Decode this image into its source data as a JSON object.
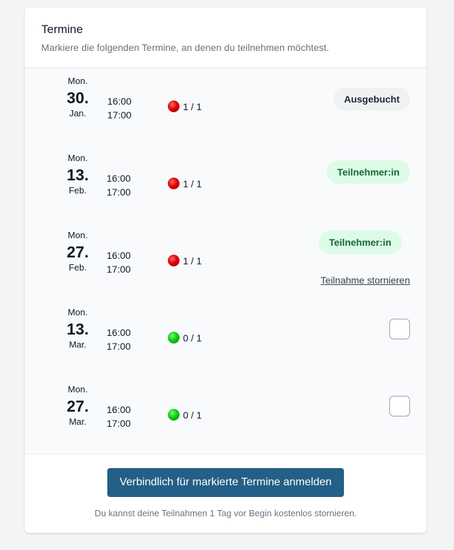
{
  "header": {
    "title": "Termine",
    "subtitle": "Markiere die folgenden Termine, an denen du teilnehmen möchtest."
  },
  "appointments": [
    {
      "weekday": "Mon.",
      "day": "30.",
      "month": "Jan.",
      "start": "16:00",
      "end": "17:00",
      "slots": "1 / 1",
      "availability": "full",
      "status": "Ausgebucht"
    },
    {
      "weekday": "Mon.",
      "day": "13.",
      "month": "Feb.",
      "start": "16:00",
      "end": "17:00",
      "slots": "1 / 1",
      "availability": "full",
      "status": "Teilnehmer:in"
    },
    {
      "weekday": "Mon.",
      "day": "27.",
      "month": "Feb.",
      "start": "16:00",
      "end": "17:00",
      "slots": "1 / 1",
      "availability": "full",
      "status": "Teilnehmer:in",
      "cancel_label": "Teilnahme stornieren"
    },
    {
      "weekday": "Mon.",
      "day": "13.",
      "month": "Mar.",
      "start": "16:00",
      "end": "17:00",
      "slots": "0 / 1",
      "availability": "open",
      "checked": false
    },
    {
      "weekday": "Mon.",
      "day": "27.",
      "month": "Mar.",
      "start": "16:00",
      "end": "17:00",
      "slots": "0 / 1",
      "availability": "open",
      "checked": false
    }
  ],
  "footer": {
    "submit_label": "Verbindlich für markierte Termine anmelden",
    "note": "Du kannst deine Teilnahmen 1 Tag vor Begin kostenlos stornieren."
  },
  "colors": {
    "primary_button": "#235f86",
    "available_dot": "#12c812",
    "full_dot": "#e00000",
    "participant_badge_bg": "#dcfce7",
    "participant_badge_text": "#166534"
  }
}
